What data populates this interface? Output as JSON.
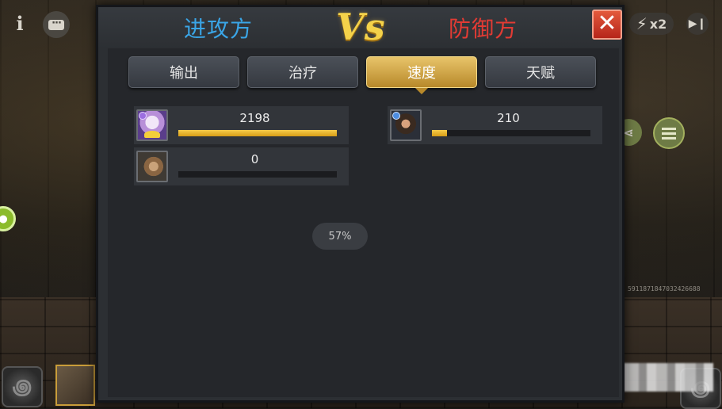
{
  "header": {
    "attacker_title": "进攻方",
    "vs_label": "Vs",
    "defender_title": "防御方",
    "close_symbol": "✕"
  },
  "tabs": [
    {
      "label": "输出",
      "active": false
    },
    {
      "label": "治疗",
      "active": false
    },
    {
      "label": "速度",
      "active": true
    },
    {
      "label": "天赋",
      "active": false
    }
  ],
  "attackers": [
    {
      "value": "2198",
      "fill_fraction": 1.0,
      "icon": "mage-hero-portrait"
    },
    {
      "value": "0",
      "fill_fraction": 0.0,
      "icon": "beast-hero-portrait"
    }
  ],
  "defenders": [
    {
      "value": "210",
      "fill_fraction": 0.096,
      "icon": "warrior-hero-portrait"
    }
  ],
  "progress_label": "57%",
  "hud": {
    "info_symbol": "i",
    "speed_label": "x2",
    "user_id": "5911871847032426688"
  },
  "colors": {
    "attacker": "#3aa5e6",
    "defender": "#e23b34",
    "vs": "#f4d24a",
    "bar_fill": "#f0b92e",
    "active_tab": "#d9ad4c"
  }
}
